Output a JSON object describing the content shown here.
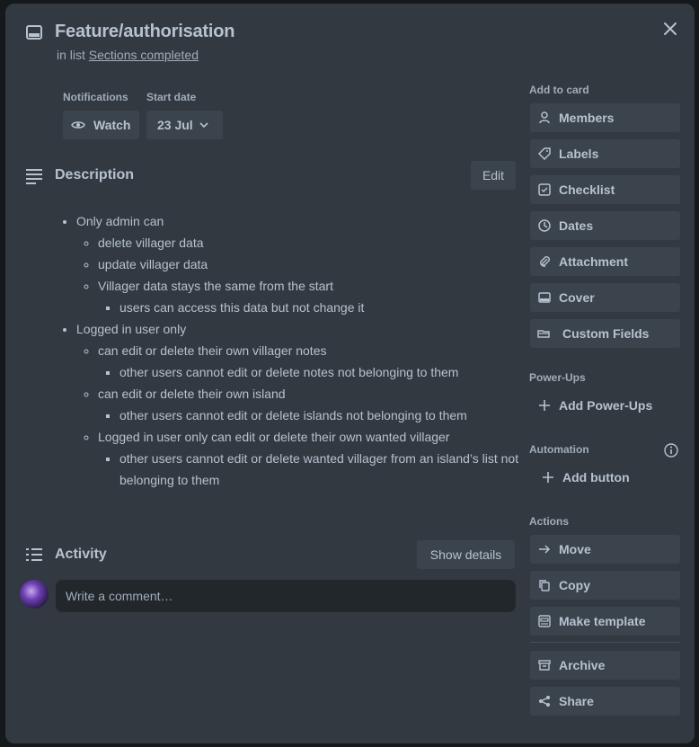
{
  "card": {
    "title": "Feature/authorisation",
    "in_list_prefix": "in list",
    "list_name": "Sections completed"
  },
  "meta": {
    "notifications_label": "Notifications",
    "watch_label": "Watch",
    "start_date_label": "Start date",
    "start_date_value": "23 Jul"
  },
  "description": {
    "title": "Description",
    "edit_label": "Edit",
    "items": [
      {
        "text": "Only admin can",
        "children": [
          {
            "text": "delete villager data"
          },
          {
            "text": "update villager data"
          },
          {
            "text": "Villager data stays the same from the start",
            "children": [
              {
                "text": "users can access this data but not change it"
              }
            ]
          }
        ]
      },
      {
        "text": "Logged in user only",
        "children": [
          {
            "text": "can edit or delete their own villager notes",
            "children": [
              {
                "text": "other users cannot edit or delete notes not belonging to them"
              }
            ]
          },
          {
            "text": "can edit or delete their own island",
            "children": [
              {
                "text": "other users cannot edit or delete islands not belonging to them"
              }
            ]
          },
          {
            "text": "Logged in user only can edit or delete their own wanted villager",
            "children": [
              {
                "text": "other users cannot edit or delete wanted villager from an island’s list not belonging to them"
              }
            ]
          }
        ]
      }
    ]
  },
  "activity": {
    "title": "Activity",
    "show_details_label": "Show details",
    "comment_placeholder": "Write a comment…"
  },
  "sidebar": {
    "add_to_card_label": "Add to card",
    "add_to_card": [
      "Members",
      "Labels",
      "Checklist",
      "Dates",
      "Attachment",
      "Cover",
      "Custom Fields"
    ],
    "power_ups_label": "Power-Ups",
    "add_power_ups": "Add Power-Ups",
    "automation_label": "Automation",
    "add_button": "Add button",
    "actions_label": "Actions",
    "actions": [
      "Move",
      "Copy",
      "Make template",
      "Archive",
      "Share"
    ]
  },
  "colors": {
    "modal_bg": "#323940",
    "button_bg": "#3b444c",
    "text": "#b6c2cf",
    "subtle_text": "#9fadbc",
    "input_bg": "#22272b"
  }
}
